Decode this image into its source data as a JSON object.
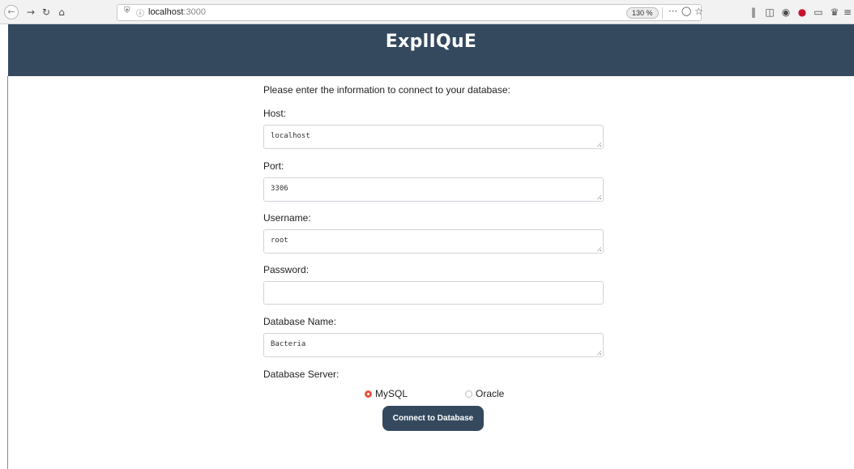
{
  "browser": {
    "url_host": "localhost",
    "url_port": ":3000",
    "zoom": "130 %"
  },
  "app": {
    "title": "ExplIQuE"
  },
  "form": {
    "intro": "Please enter the information to connect to your database:",
    "host": {
      "label": "Host:",
      "value": "localhost"
    },
    "port": {
      "label": "Port:",
      "value": "3306"
    },
    "username": {
      "label": "Username:",
      "value": "root"
    },
    "password": {
      "label": "Password:",
      "value": ""
    },
    "database_name": {
      "label": "Database Name:",
      "value": "Bacteria"
    },
    "database_server": {
      "label": "Database Server:",
      "options": [
        {
          "label": "MySQL",
          "selected": true
        },
        {
          "label": "Oracle",
          "selected": false
        }
      ]
    },
    "submit_label": "Connect to Database"
  },
  "colors": {
    "header_bg": "#34495e",
    "button_bg": "#34495e",
    "radio_accent": "#e8543f"
  }
}
